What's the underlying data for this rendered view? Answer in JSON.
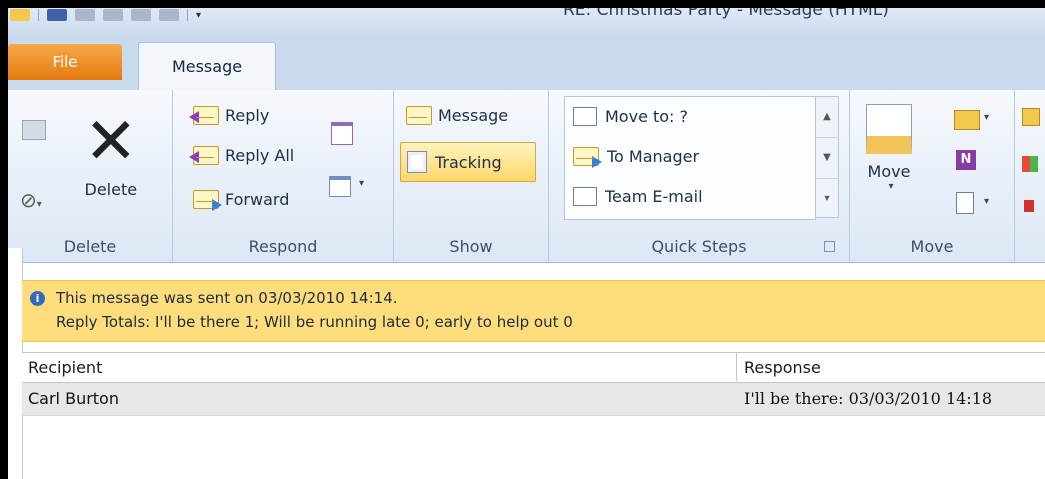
{
  "window": {
    "title": "RE: Christmas Party - Message (HTML)"
  },
  "tabs": {
    "file": "File",
    "message": "Message"
  },
  "ribbon": {
    "groups": {
      "delete": {
        "label": "Delete",
        "delete_button": "Delete"
      },
      "respond": {
        "label": "Respond",
        "reply": "Reply",
        "reply_all": "Reply All",
        "forward": "Forward"
      },
      "show": {
        "label": "Show",
        "message": "Message",
        "tracking": "Tracking"
      },
      "quick_steps": {
        "label": "Quick Steps",
        "items": [
          "Move to: ?",
          "To Manager",
          "Team E-mail"
        ]
      },
      "move": {
        "label": "Move",
        "move_button": "Move"
      }
    }
  },
  "infobar": {
    "line1": "This message was sent on 03/03/2010 14:14.",
    "line2": "Reply Totals: I'll be there 1; Will be running late 0; early to help out 0"
  },
  "tracking_table": {
    "columns": [
      "Recipient",
      "Response"
    ],
    "rows": [
      {
        "recipient": "Carl Burton",
        "response": "I'll be there: 03/03/2010 14:18"
      }
    ]
  },
  "colors": {
    "file_tab": "#e47a0e",
    "infobar": "#ffdc7c",
    "ribbon": "#dce7f5",
    "highlight": "#ffd76b"
  }
}
